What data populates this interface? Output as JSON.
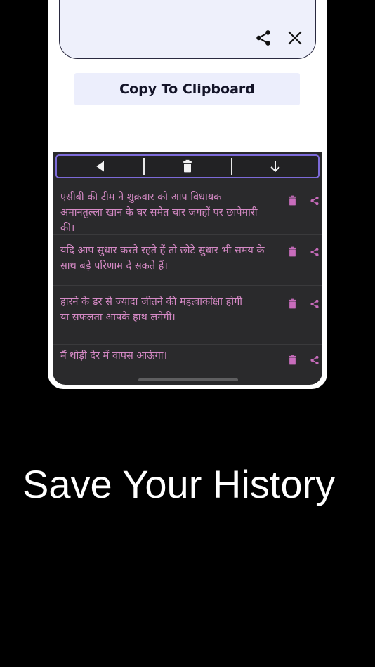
{
  "editor": {
    "share_icon": "share-icon",
    "close_icon": "close-icon"
  },
  "copy_button": {
    "label": "Copy To Clipboard"
  },
  "history": {
    "toolbar": {
      "back_icon": "back-arrow-icon",
      "delete_icon": "trash-icon",
      "download_icon": "download-arrow-icon",
      "accent_color": "#7c6ad8"
    },
    "items": [
      {
        "text": "एसीबी की टीम ने शुक्रवार को आप विधायक अमानतुल्ला खान के घर समेत चार जगहों पर छापेमारी की।"
      },
      {
        "text": "यदि आप सुधार करते रहते हैं तो छोटे सुधार भी समय के साथ बड़े परिणाम दे सकते हैं।"
      },
      {
        "text": "हारने के डर से ज्यादा जीतने की महत्वाकांक्षा होगी या सफलता आपके हाथ लगेगी।"
      },
      {
        "text": "मैं थोड़ी देर में वापस आऊंगा।"
      }
    ],
    "text_color": "#d68ac6"
  },
  "headline": {
    "text": "Save Your History"
  }
}
